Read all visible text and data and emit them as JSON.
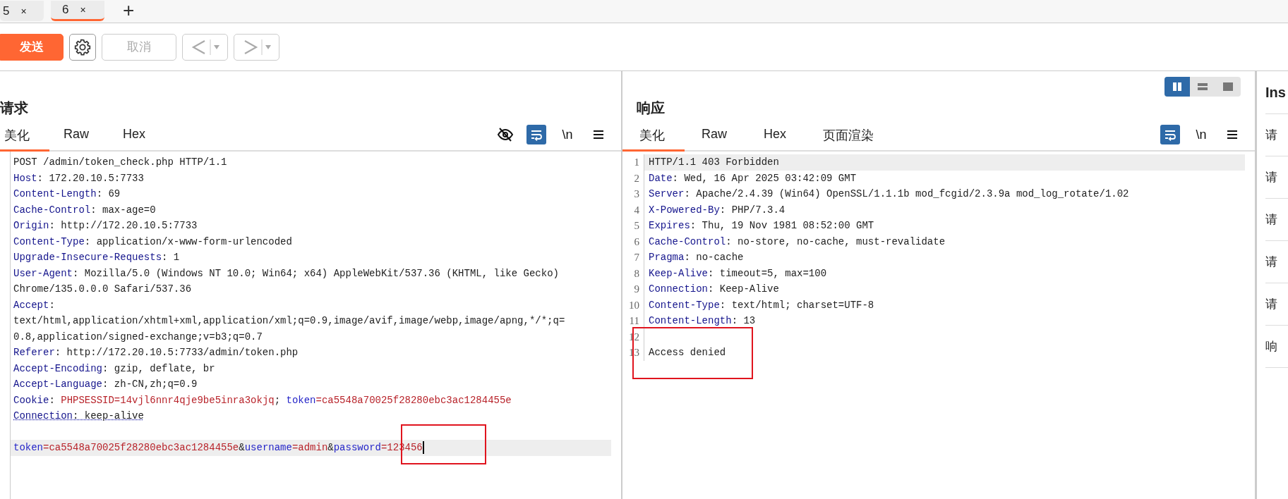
{
  "page_tabs": [
    {
      "label": "5",
      "close": "×",
      "selected": false
    },
    {
      "label": "6",
      "close": "×",
      "selected": true
    }
  ],
  "add_tab": "+",
  "toolbar": {
    "send": "发送",
    "cancel": {
      "label": "取消",
      "disabled": true
    },
    "back": {
      "disabled": true
    },
    "forward": {
      "disabled": true
    }
  },
  "request": {
    "title": "请求",
    "tabs": [
      {
        "label": "美化",
        "selected": true
      },
      {
        "label": "Raw",
        "selected": false
      },
      {
        "label": "Hex",
        "selected": false
      }
    ],
    "tools": [
      {
        "kind": "eye",
        "selected": false
      },
      {
        "kind": "wrap",
        "selected": true
      },
      {
        "kind": "newline",
        "label": "\\n",
        "selected": false
      },
      {
        "kind": "menu",
        "selected": false
      }
    ],
    "lines": [
      {
        "segs": [
          {
            "kind": "p",
            "text": "POST /admin/token_check.php HTTP/1.1"
          }
        ]
      },
      {
        "segs": [
          {
            "kind": "h",
            "text": "Host"
          },
          {
            "kind": "p",
            "text": ": 172.20.10.5:7733"
          }
        ]
      },
      {
        "segs": [
          {
            "kind": "h",
            "text": "Content-Length"
          },
          {
            "kind": "p",
            "text": ": 69"
          }
        ]
      },
      {
        "segs": [
          {
            "kind": "h",
            "text": "Cache-Control"
          },
          {
            "kind": "p",
            "text": ": max-age=0"
          }
        ]
      },
      {
        "segs": [
          {
            "kind": "h",
            "text": "Origin"
          },
          {
            "kind": "p",
            "text": ": http://172.20.10.5:7733"
          }
        ]
      },
      {
        "segs": [
          {
            "kind": "h",
            "text": "Content-Type"
          },
          {
            "kind": "p",
            "text": ": application/x-www-form-urlencoded"
          }
        ]
      },
      {
        "segs": [
          {
            "kind": "h",
            "text": "Upgrade-Insecure-Requests"
          },
          {
            "kind": "p",
            "text": ": 1"
          }
        ]
      },
      {
        "segs": [
          {
            "kind": "h",
            "text": "User-Agent"
          },
          {
            "kind": "p",
            "text": ": Mozilla/5.0 (Windows NT 10.0; Win64; x64) AppleWebKit/537.36 (KHTML, like Gecko)"
          }
        ]
      },
      {
        "segs": [
          {
            "kind": "p",
            "text": "Chrome/135.0.0.0 Safari/537.36"
          }
        ]
      },
      {
        "segs": [
          {
            "kind": "h",
            "text": "Accept"
          },
          {
            "kind": "p",
            "text": ":"
          }
        ]
      },
      {
        "segs": [
          {
            "kind": "p",
            "text": "text/html,application/xhtml+xml,application/xml;q=0.9,image/avif,image/webp,image/apng,*/*;q="
          }
        ]
      },
      {
        "segs": [
          {
            "kind": "p",
            "text": "0.8,application/signed-exchange;v=b3;q=0.7"
          }
        ]
      },
      {
        "segs": [
          {
            "kind": "h",
            "text": "Referer"
          },
          {
            "kind": "p",
            "text": ": http://172.20.10.5:7733/admin/token.php"
          }
        ]
      },
      {
        "segs": [
          {
            "kind": "h",
            "text": "Accept-Encoding"
          },
          {
            "kind": "p",
            "text": ": gzip, deflate, br"
          }
        ]
      },
      {
        "segs": [
          {
            "kind": "h",
            "text": "Accept-Language"
          },
          {
            "kind": "p",
            "text": ": zh-CN,zh;q=0.9"
          }
        ]
      },
      {
        "segs": [
          {
            "kind": "h",
            "text": "Cookie"
          },
          {
            "kind": "p",
            "text": ": "
          },
          {
            "kind": "v",
            "text": "PHPSESSID=14vjl6nnr4qje9be5inra3okjq"
          },
          {
            "kind": "p",
            "text": "; "
          },
          {
            "kind": "n",
            "text": "token"
          },
          {
            "kind": "v",
            "text": "=ca5548a70025f28280ebc3ac1284455e"
          }
        ]
      },
      {
        "segs": [
          {
            "kind": "h",
            "text": "Connection"
          },
          {
            "kind": "p",
            "text": ": keep-alive"
          }
        ],
        "underlined": true
      },
      {
        "space_before": true,
        "segs": [
          {
            "kind": "n",
            "text": "token"
          },
          {
            "kind": "v",
            "text": "=ca5548a70025f28280ebc3ac1284455e"
          },
          {
            "kind": "p",
            "text": "&"
          },
          {
            "kind": "n",
            "text": "username"
          },
          {
            "kind": "v",
            "text": "=admin"
          },
          {
            "kind": "p",
            "text": "&"
          },
          {
            "kind": "n",
            "text": "password"
          },
          {
            "kind": "v",
            "text": "=123456"
          }
        ],
        "current": true,
        "cursor": true
      }
    ]
  },
  "response": {
    "title": "响应",
    "views": [
      {
        "kind": "split",
        "selected": true
      },
      {
        "kind": "stacked",
        "selected": false
      },
      {
        "kind": "single",
        "selected": false
      }
    ],
    "tabs": [
      {
        "label": "美化",
        "selected": true
      },
      {
        "label": "Raw",
        "selected": false
      },
      {
        "label": "Hex",
        "selected": false
      },
      {
        "label": "页面渲染",
        "selected": false
      }
    ],
    "tools": [
      {
        "kind": "wrap",
        "selected": true
      },
      {
        "kind": "newline",
        "label": "\\n",
        "selected": false
      },
      {
        "kind": "menu",
        "selected": false
      }
    ],
    "lines": [
      {
        "n": "1",
        "segs": [
          {
            "kind": "p",
            "text": "HTTP/1.1 403 Forbidden"
          }
        ],
        "current": true
      },
      {
        "n": "2",
        "segs": [
          {
            "kind": "h",
            "text": "Date"
          },
          {
            "kind": "p",
            "text": ": Wed, 16 Apr 2025 03:42:09 GMT"
          }
        ]
      },
      {
        "n": "3",
        "segs": [
          {
            "kind": "h",
            "text": "Server"
          },
          {
            "kind": "p",
            "text": ": Apache/2.4.39 (Win64) OpenSSL/1.1.1b mod_fcgid/2.3.9a mod_log_rotate/1.02"
          }
        ]
      },
      {
        "n": "4",
        "segs": [
          {
            "kind": "h",
            "text": "X-Powered-By"
          },
          {
            "kind": "p",
            "text": ": PHP/7.3.4"
          }
        ]
      },
      {
        "n": "5",
        "segs": [
          {
            "kind": "h",
            "text": "Expires"
          },
          {
            "kind": "p",
            "text": ": Thu, 19 Nov 1981 08:52:00 GMT"
          }
        ]
      },
      {
        "n": "6",
        "segs": [
          {
            "kind": "h",
            "text": "Cache-Control"
          },
          {
            "kind": "p",
            "text": ": no-store, no-cache, must-revalidate"
          }
        ]
      },
      {
        "n": "7",
        "segs": [
          {
            "kind": "h",
            "text": "Pragma"
          },
          {
            "kind": "p",
            "text": ": no-cache"
          }
        ]
      },
      {
        "n": "8",
        "segs": [
          {
            "kind": "h",
            "text": "Keep-Alive"
          },
          {
            "kind": "p",
            "text": ": timeout=5, max=100"
          }
        ]
      },
      {
        "n": "9",
        "segs": [
          {
            "kind": "h",
            "text": "Connection"
          },
          {
            "kind": "p",
            "text": ": Keep-Alive"
          }
        ]
      },
      {
        "n": "10",
        "segs": [
          {
            "kind": "h",
            "text": "Content-Type"
          },
          {
            "kind": "p",
            "text": ": text/html; charset=UTF-8"
          }
        ]
      },
      {
        "n": "11",
        "segs": [
          {
            "kind": "h",
            "text": "Content-Length"
          },
          {
            "kind": "p",
            "text": ": 13"
          }
        ]
      },
      {
        "n": "12"
      },
      {
        "n": "13",
        "segs": [
          {
            "kind": "p",
            "text": "Access denied"
          }
        ]
      }
    ]
  },
  "inspector": {
    "title": "Ins",
    "items": [
      "请",
      "请",
      "请",
      "请",
      "请",
      "响"
    ]
  }
}
